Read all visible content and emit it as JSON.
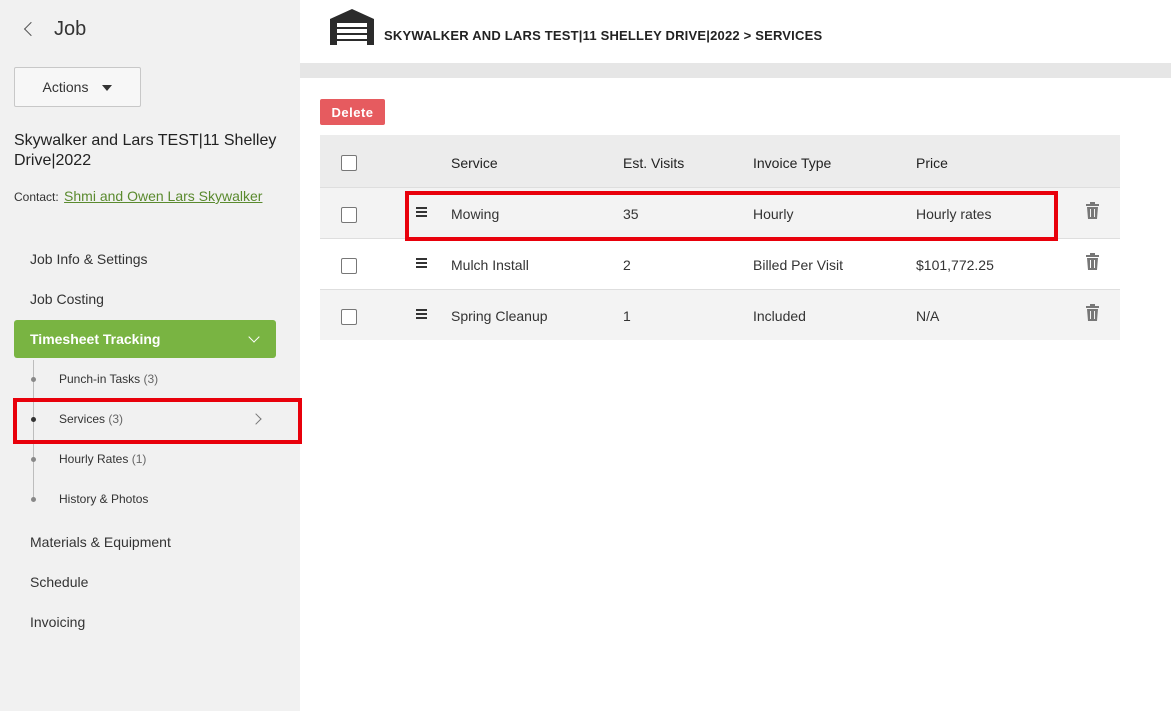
{
  "sidebar": {
    "back_title": "Job",
    "actions_label": "Actions",
    "job_title": "Skywalker and Lars TEST|11 Shelley Drive|2022",
    "contact_label": "Contact:",
    "contact_name": "Shmi and Owen Lars Skywalker",
    "nav": {
      "job_info": "Job Info & Settings",
      "job_costing": "Job Costing",
      "timesheet": "Timesheet Tracking",
      "materials": "Materials & Equipment",
      "schedule": "Schedule",
      "invoicing": "Invoicing"
    },
    "sub_items": [
      {
        "label": "Punch-in Tasks",
        "count": "(3)"
      },
      {
        "label": "Services",
        "count": "(3)"
      },
      {
        "label": "Hourly Rates",
        "count": "(1)"
      },
      {
        "label": "History & Photos",
        "count": ""
      }
    ]
  },
  "header": {
    "breadcrumb": "SKYWALKER AND LARS TEST|11 SHELLEY DRIVE|2022 > SERVICES",
    "icon": "garage-icon"
  },
  "toolbar": {
    "delete_label": "Delete"
  },
  "table": {
    "columns": [
      "Service",
      "Est. Visits",
      "Invoice Type",
      "Price"
    ],
    "rows": [
      {
        "service": "Mowing",
        "visits": "35",
        "invoice_type": "Hourly",
        "price": "Hourly rates"
      },
      {
        "service": "Mulch Install",
        "visits": "2",
        "invoice_type": "Billed Per Visit",
        "price": "$101,772.25"
      },
      {
        "service": "Spring Cleanup",
        "visits": "1",
        "invoice_type": "Included",
        "price": "N/A"
      }
    ]
  },
  "colors": {
    "accent_green": "#79b442",
    "link_green": "#5a8a2e",
    "delete_red": "#e65b5f",
    "highlight_red": "#e8000b"
  }
}
